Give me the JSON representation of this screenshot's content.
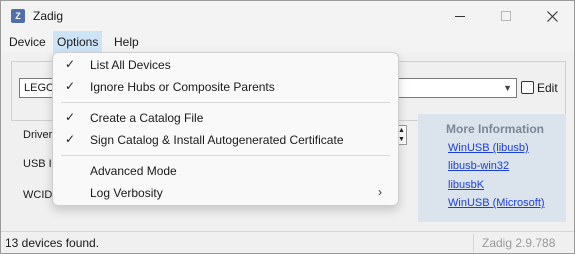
{
  "app": {
    "title": "Zadig",
    "icon_letter": "Z"
  },
  "menubar": {
    "device": "Device",
    "options": "Options",
    "help": "Help"
  },
  "device_combo": {
    "value": "LEGO"
  },
  "edit_label": "Edit",
  "labels": {
    "driver": "Driver",
    "usb_id": "USB ID",
    "wcid": "WCID"
  },
  "info": {
    "title": "More Information",
    "links": [
      "WinUSB (libusb)",
      "libusb-win32",
      "libusbK",
      "WinUSB (Microsoft)"
    ]
  },
  "status": {
    "left": "13 devices found.",
    "right": "Zadig 2.9.788"
  },
  "options_menu": {
    "items": [
      {
        "label": "List All Devices",
        "checked": true
      },
      {
        "label": "Ignore Hubs or Composite Parents",
        "checked": true
      },
      {
        "label": "Create a Catalog File",
        "checked": true
      },
      {
        "label": "Sign Catalog & Install Autogenerated Certificate",
        "checked": true
      },
      {
        "label": "Advanced Mode",
        "checked": false
      },
      {
        "label": "Log Verbosity",
        "checked": false,
        "submenu": true
      }
    ]
  },
  "icons": {
    "check": "checkmark-icon",
    "submenu": "chevron-right-icon",
    "close": "close-icon"
  }
}
